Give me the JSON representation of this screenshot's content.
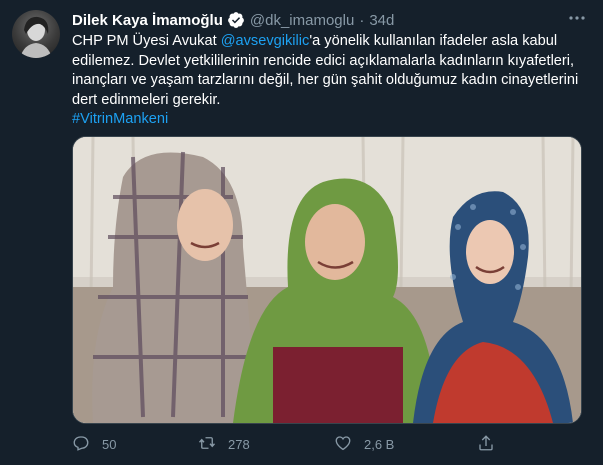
{
  "author": {
    "name": "Dilek Kaya İmamoğlu",
    "handle": "@dk_imamoglu",
    "separator": "·",
    "time": "34d"
  },
  "tweet": {
    "text_part1": "CHP PM Üyesi Avukat ",
    "mention": "@avsevgikilic",
    "text_part2": "'a yönelik kullanılan ifadeler asla kabul edilemez. Devlet yetkililerinin rencide edici açıklamalarla kadınların kıyafetleri, inançları ve yaşam tarzlarını değil, her gün şahit olduğumuz kadın cinayetlerini dert edinmeleri gerekir.",
    "hashtag": "#VitrinMankeni"
  },
  "actions": {
    "reply_count": "50",
    "retweet_count": "278",
    "like_count": "2,6 B"
  },
  "icons": {
    "more": "more-horizontal-icon",
    "reply": "reply-icon",
    "retweet": "retweet-icon",
    "like": "heart-icon",
    "share": "share-icon",
    "verified": "verified-badge-icon"
  },
  "colors": {
    "background": "#15202b",
    "accent": "#1da1f2",
    "secondary_text": "#8899a6"
  }
}
